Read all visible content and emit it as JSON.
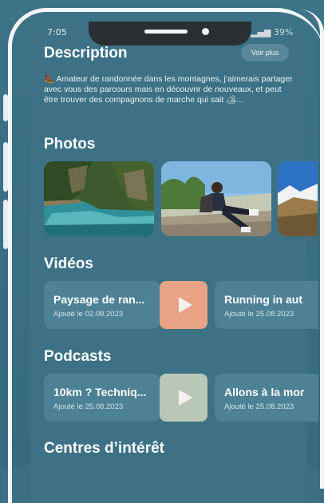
{
  "status": {
    "time": "7:05",
    "battery": "39%"
  },
  "description": {
    "heading": "Description",
    "more_label": "Voir plus",
    "text": "🥾 Amateur de randonnée dans les montagnes, j'aimerais partager avec vous des parcours mais en découvrir de nouveaux, et peut être trouver des compagnons de marche qui sait 🏕..."
  },
  "photos": {
    "heading": "Photos"
  },
  "videos": {
    "heading": "Vidéos",
    "items": [
      {
        "title": "Paysage de ran...",
        "date": "Ajouté le 02.08.2023"
      },
      {
        "title": "Running in aut",
        "date": "Ajouté le 25.08.2023"
      }
    ]
  },
  "podcasts": {
    "heading": "Podcasts",
    "items": [
      {
        "title": "10km ? Techniq...",
        "date": "Ajouté le 25.08.2023"
      },
      {
        "title": "Allons à la mor",
        "date": "Ajouté le 25.08.2023"
      }
    ]
  },
  "interests": {
    "heading": "Centres d’intérêt"
  },
  "colors": {
    "background": "#3c7186",
    "card": "#4d8196",
    "video_play": "#e8a385",
    "podcast_play": "#b9c7b6"
  }
}
